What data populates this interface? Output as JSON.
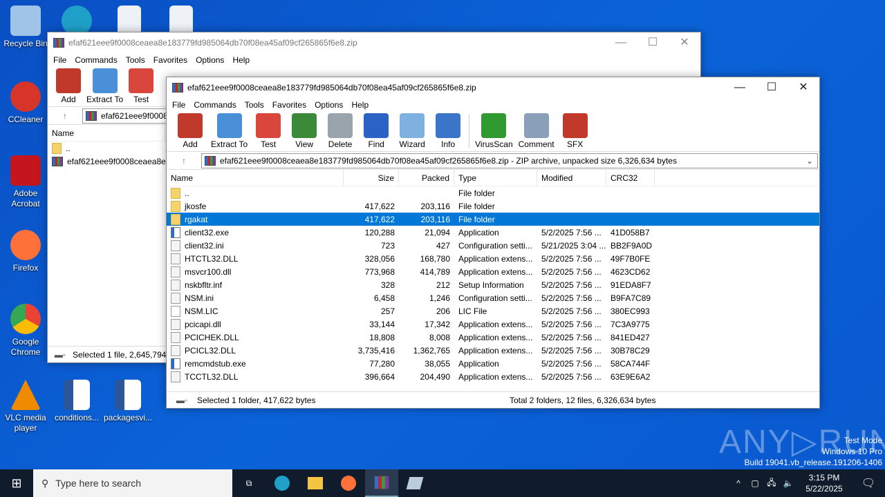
{
  "desktop": {
    "icons": [
      {
        "label": "Recycle Bin",
        "color": "#9fc4e8"
      },
      {
        "label": "CCleaner",
        "color": "#d8352a"
      },
      {
        "label": "Adobe Acrobat",
        "color": "#c4161c"
      },
      {
        "label": "Firefox",
        "color": "#ff7139"
      },
      {
        "label": "Google Chrome",
        "color": "#34a853"
      },
      {
        "label": "VLC media player",
        "color": "#f08a00"
      },
      {
        "label": "conditions...",
        "color": "#2b579a"
      },
      {
        "label": "packagesvi...",
        "color": "#2b579a"
      }
    ]
  },
  "back_window": {
    "title": "efaf621eee9f0008ceaea8e183779fd985064db70f08ea45af09cf265865f6e8.zip",
    "menu": [
      "File",
      "Commands",
      "Tools",
      "Favorites",
      "Options",
      "Help"
    ],
    "toolbar": [
      "Add",
      "Extract To",
      "Test"
    ],
    "address": "efaf621eee9f0008ce",
    "col_name": "Name",
    "rows": [
      "..",
      "efaf621eee9f0008ceaea8e183"
    ],
    "status": "Selected 1 file, 2,645,794"
  },
  "front_window": {
    "title": "efaf621eee9f0008ceaea8e183779fd985064db70f08ea45af09cf265865f6e8.zip",
    "menu": [
      "File",
      "Commands",
      "Tools",
      "Favorites",
      "Options",
      "Help"
    ],
    "toolbar": [
      {
        "label": "Add",
        "color": "#c0392b"
      },
      {
        "label": "Extract To",
        "color": "#4a90d9"
      },
      {
        "label": "Test",
        "color": "#d9463b"
      },
      {
        "label": "View",
        "color": "#3a8a3a"
      },
      {
        "label": "Delete",
        "color": "#9aa4ad"
      },
      {
        "label": "Find",
        "color": "#2a63c4"
      },
      {
        "label": "Wizard",
        "color": "#7fb1e0"
      },
      {
        "label": "Info",
        "color": "#3a75c9"
      },
      {
        "label": "VirusScan",
        "color": "#2f9a2f"
      },
      {
        "label": "Comment",
        "color": "#8aa0b8"
      },
      {
        "label": "SFX",
        "color": "#c0392b"
      }
    ],
    "address": "efaf621eee9f0008ceaea8e183779fd985064db70f08ea45af09cf265865f6e8.zip - ZIP archive, unpacked size 6,326,634 bytes",
    "columns": [
      "Name",
      "Size",
      "Packed",
      "Type",
      "Modified",
      "CRC32"
    ],
    "rows": [
      {
        "name": "..",
        "size": "",
        "packed": "",
        "type": "File folder",
        "modified": "",
        "crc": "",
        "icon": "folder"
      },
      {
        "name": "jkosfe",
        "size": "417,622",
        "packed": "203,116",
        "type": "File folder",
        "modified": "",
        "crc": "",
        "icon": "folder"
      },
      {
        "name": "rgakat",
        "size": "417,622",
        "packed": "203,116",
        "type": "File folder",
        "modified": "",
        "crc": "",
        "icon": "folder",
        "selected": true
      },
      {
        "name": "client32.exe",
        "size": "120,288",
        "packed": "21,094",
        "type": "Application",
        "modified": "5/2/2025 7:56 ...",
        "crc": "41D058B7",
        "icon": "exe"
      },
      {
        "name": "client32.ini",
        "size": "723",
        "packed": "427",
        "type": "Configuration setti...",
        "modified": "5/21/2025 3:04 ...",
        "crc": "BB2F9A0D",
        "icon": "gear"
      },
      {
        "name": "HTCTL32.DLL",
        "size": "328,056",
        "packed": "168,780",
        "type": "Application extens...",
        "modified": "5/2/2025 7:56 ...",
        "crc": "49F7B0FE",
        "icon": "gear"
      },
      {
        "name": "msvcr100.dll",
        "size": "773,968",
        "packed": "414,789",
        "type": "Application extens...",
        "modified": "5/2/2025 7:56 ...",
        "crc": "4623CD62",
        "icon": "gear"
      },
      {
        "name": "nskbfltr.inf",
        "size": "328",
        "packed": "212",
        "type": "Setup Information",
        "modified": "5/2/2025 7:56 ...",
        "crc": "91EDA8F7",
        "icon": "gear"
      },
      {
        "name": "NSM.ini",
        "size": "6,458",
        "packed": "1,246",
        "type": "Configuration setti...",
        "modified": "5/2/2025 7:56 ...",
        "crc": "B9FA7C89",
        "icon": "gear"
      },
      {
        "name": "NSM.LIC",
        "size": "257",
        "packed": "206",
        "type": "LIC File",
        "modified": "5/2/2025 7:56 ...",
        "crc": "380EC993",
        "icon": "doc"
      },
      {
        "name": "pcicapi.dll",
        "size": "33,144",
        "packed": "17,342",
        "type": "Application extens...",
        "modified": "5/2/2025 7:56 ...",
        "crc": "7C3A9775",
        "icon": "gear"
      },
      {
        "name": "PCICHEK.DLL",
        "size": "18,808",
        "packed": "8,008",
        "type": "Application extens...",
        "modified": "5/2/2025 7:56 ...",
        "crc": "841ED427",
        "icon": "gear"
      },
      {
        "name": "PCICL32.DLL",
        "size": "3,735,416",
        "packed": "1,362,765",
        "type": "Application extens...",
        "modified": "5/2/2025 7:56 ...",
        "crc": "30B78C29",
        "icon": "gear"
      },
      {
        "name": "remcmdstub.exe",
        "size": "77,280",
        "packed": "38,055",
        "type": "Application",
        "modified": "5/2/2025 7:56 ...",
        "crc": "58CA744F",
        "icon": "exe"
      },
      {
        "name": "TCCTL32.DLL",
        "size": "396,664",
        "packed": "204,490",
        "type": "Application extens...",
        "modified": "5/2/2025 7:56 ...",
        "crc": "63E9E6A2",
        "icon": "gear"
      }
    ],
    "status_left": "Selected 1 folder, 417,622 bytes",
    "status_right": "Total 2 folders, 12 files, 6,326,634 bytes"
  },
  "watermark": {
    "logo": "ANY RUN",
    "line1": "Test Mode",
    "line2": "Windows 10 Pro",
    "line3": "Build 19041.vb_release.191206-1406"
  },
  "taskbar": {
    "search_placeholder": "Type here to search",
    "time": "3:15 PM",
    "date": "5/22/2025"
  }
}
